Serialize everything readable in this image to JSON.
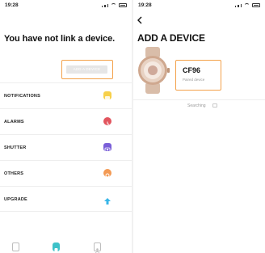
{
  "left_screen": {
    "status_time": "19:28",
    "headline": "You have not link a device.",
    "add_device_button": "ADD A DEVICE",
    "menu": [
      {
        "label": "NOTIFICATIONS",
        "icon": "notification-icon",
        "color": "#f7d04a"
      },
      {
        "label": "ALARMS",
        "icon": "alarm-icon",
        "color": "#e2555e"
      },
      {
        "label": "SHUTTER",
        "icon": "camera-icon",
        "color": "#7a5fd8"
      },
      {
        "label": "OTHERS",
        "icon": "gear-icon",
        "color": "#f39a54"
      },
      {
        "label": "UPGRADE",
        "icon": "upgrade-icon",
        "color": "#38b6e8"
      }
    ],
    "tabbar": [
      {
        "icon": "device-tab-icon",
        "active": false
      },
      {
        "icon": "watch-tab-icon",
        "active": true
      },
      {
        "icon": "profile-tab-icon",
        "active": false
      }
    ]
  },
  "right_screen": {
    "status_time": "19:28",
    "title": "ADD A DEVICE",
    "device_name": "CF96",
    "device_status": "Paired device",
    "searching_text": "Searching"
  },
  "colors": {
    "highlight_outline": "#f3a14a",
    "active_tab": "#3ec2c9",
    "watch_rose_gold": "#d7b49c"
  }
}
